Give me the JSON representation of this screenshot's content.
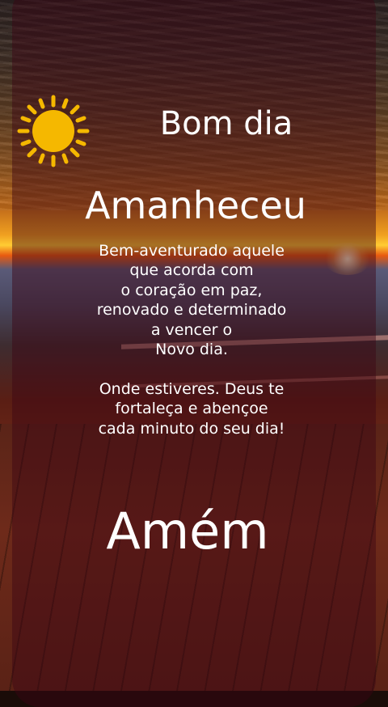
{
  "greeting": "Bom dia",
  "headline": "Amanheceu",
  "message_lines": [
    "Bem-aventurado aquele",
    "que acorda com",
    "o coração em paz,",
    "renovado e determinado",
    "a vencer o",
    "Novo dia.",
    "",
    "Onde estiveres. Deus te",
    "fortaleça e abençoe",
    "cada minuto do seu dia!"
  ],
  "closing": "Amém",
  "icons": {
    "sun": "sun-icon"
  },
  "colors": {
    "sun": "#f5b800",
    "text": "#ffffff",
    "panel": "#3c0514"
  }
}
